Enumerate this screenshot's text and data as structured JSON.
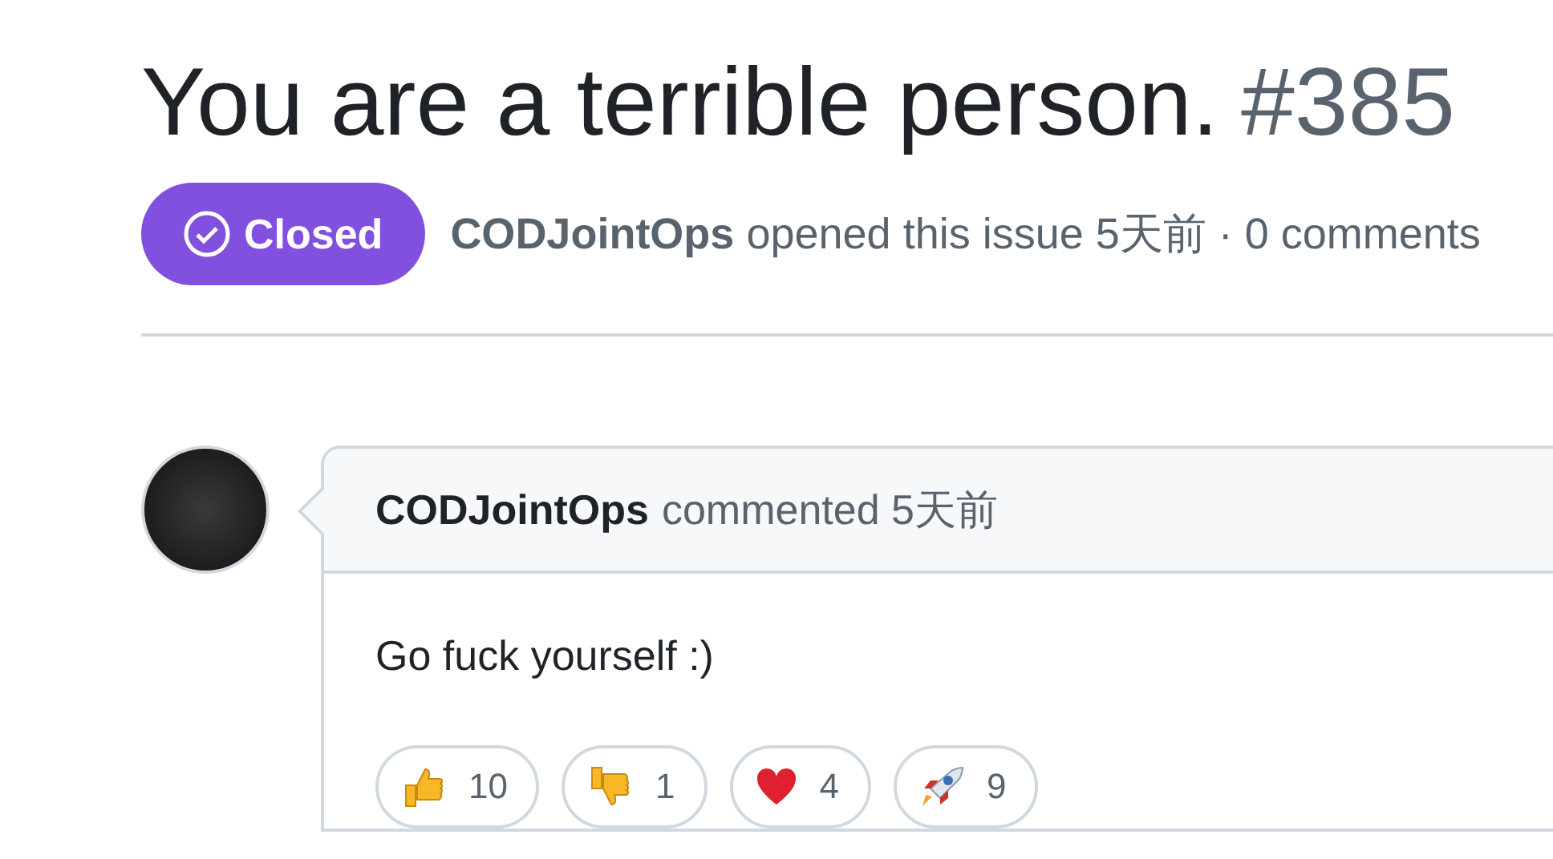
{
  "issue": {
    "title": "You are a terrible person.",
    "number": "#385",
    "state_label": "Closed",
    "author": "CODJointOps",
    "meta": "opened this issue 5天前 · 0 comments"
  },
  "comment": {
    "author": "CODJointOps",
    "action": "commented 5天前",
    "body": "Go fuck yourself :)",
    "reactions": [
      {
        "kind": "thumbs_up",
        "count": "10"
      },
      {
        "kind": "thumbs_down",
        "count": "1"
      },
      {
        "kind": "heart",
        "count": "4"
      },
      {
        "kind": "rocket",
        "count": "9"
      }
    ]
  }
}
